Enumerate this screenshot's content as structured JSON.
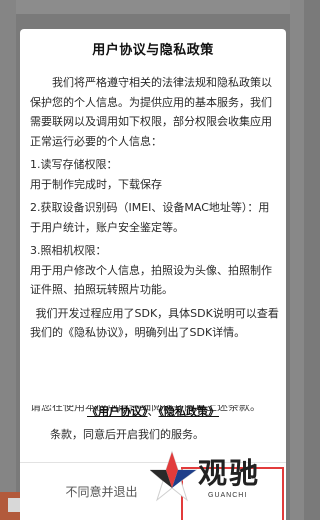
{
  "dialog": {
    "title": "用户协议与隐私政策",
    "paragraphs": [
      "我们将严格遵守相关的法律法规和隐私政策以保护您的个人信息。为提供应用的基本服务，我们需要联网以及调用如下权限，部分权限会收集应用正常运行必要的个人信息：",
      "1.读写存储权限：",
      "用于制作完成时，下载保存",
      "2.获取设备识别码（IMEI、设备MAC地址等）：用于用户统计，账户安全鉴定等。",
      "3.照相机权限：",
      "用于用户修改个人信息，拍照设为头像、拍照制作证件照、拍照玩转照片功能。",
      "我们开发过程应用了SDK，具体SDK说明可以查看我们的《隐私协议》，明确列出了SDK详情。",
      "请您在使用本应用前仔细阅读并同意上述条款。"
    ],
    "links": {
      "user_agreement": "《用户协议》",
      "separator": "、",
      "privacy_policy": "《隐私政策》"
    },
    "tail": "条款，同意后开启我们的服务。",
    "buttons": {
      "decline": "不同意并退出"
    }
  },
  "watermark": {
    "brand": "观驰",
    "sub": "GUANCHI"
  },
  "colors": {
    "accent": "#e23b3b",
    "backdrop": "#7a7a7a"
  }
}
